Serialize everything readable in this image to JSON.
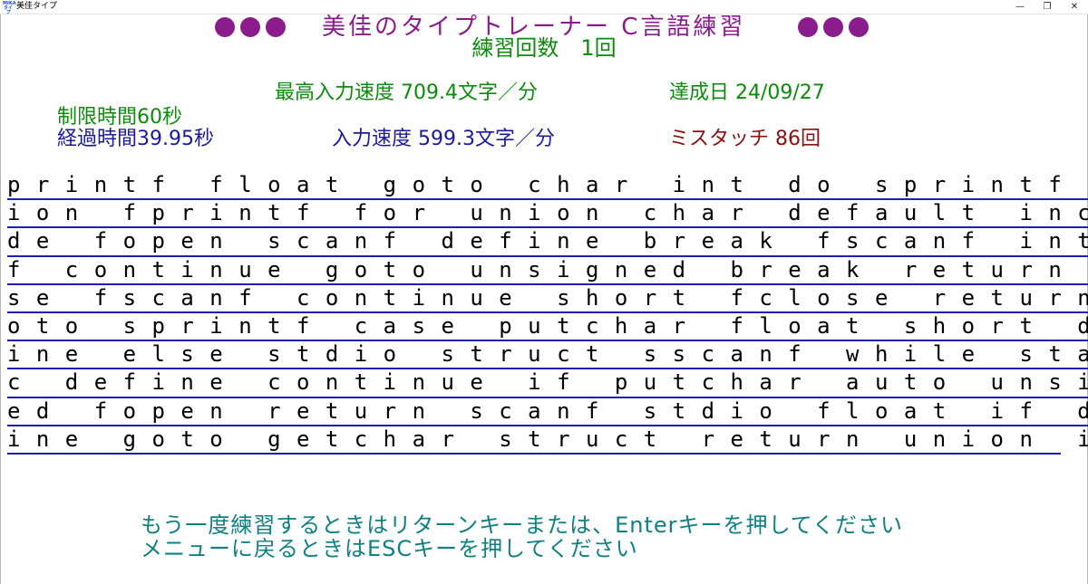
{
  "window": {
    "title": "美佳タイプ",
    "icon_text": "MIKA\nタイプ",
    "minimize_glyph": "—",
    "maximize_glyph": "❐",
    "close_glyph": "✕"
  },
  "header": {
    "title": "美佳のタイプトレーナー C言語練習",
    "dot_color": "#8b1c8b"
  },
  "practice": {
    "count_text": "練習回数　1回"
  },
  "stats": {
    "best_speed_text": "最高入力速度 709.4文字／分",
    "achieved_date_text": "達成日 24/09/27",
    "time_limit_text": "制限時間60秒",
    "elapsed_time_text": "経過時間39.95秒",
    "input_speed_text": "入力速度 599.3文字／分",
    "mistouch_text": "ミスタッチ 86回"
  },
  "typing_lines": [
    "p r i n t f   f l o a t   g o t o   c h a r   i n t   d o   s p r i n t f   u n",
    "i o n   f p r i n t f   f o r   u n i o n   c h a r   d e f a u l t   i n c l u",
    "d e   f o p e n   s c a n f   d e f i n e   b r e a k   f s c a n f   i n t   i",
    "f   c o n t i n u e   g o t o   u n s i g n e d   b r e a k   r e t u r n   e l",
    "s e   f s c a n f   c o n t i n u e   s h o r t   f c l o s e   r e t u r n   g",
    "o t o   s p r i n t f   c a s e   p u t c h a r   f l o a t   s h o r t   d e f",
    "i n e   e l s e   s t d i o   s t r u c t   s s c a n f   w h i l e   s t a t i",
    "c   d e f i n e   c o n t i n u e   i f   p u t c h a r   a u t o   u n s i g n",
    "e d   f o p e n   r e t u r n   s c a n f   s t d i o   f l o a t   i f   d e f",
    "i n e   g o t o   g e t c h a r   s t r u c t   r e t u r n   u n i o n   i f"
  ],
  "messages": {
    "retry": "もう一度練習するときはリターンキーまたは、Enterキーを押してください",
    "menu": "メニューに戻るときはESCキーを押してください"
  }
}
